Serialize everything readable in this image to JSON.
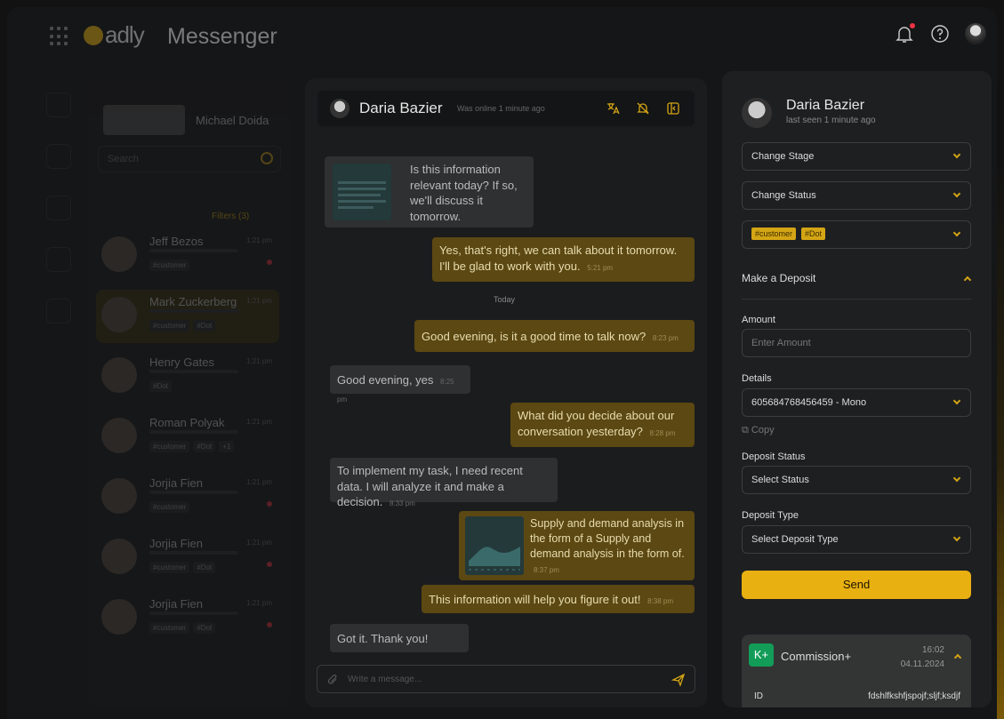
{
  "app": {
    "logo_text": "adly",
    "title": "Messenger"
  },
  "sidebar": {
    "user_name": "Michael Doida",
    "search_placeholder": "Search",
    "filters_label": "Filters (3)",
    "contacts": [
      {
        "name": "Jeff Bezos",
        "time": "1:21 pm",
        "tags": [
          "#customer"
        ],
        "unread": true
      },
      {
        "name": "Mark Zuckerberg",
        "time": "1:21 pm",
        "tags": [
          "#customer",
          "#Dot"
        ],
        "unread": false
      },
      {
        "name": "Henry Gates",
        "time": "1:21 pm",
        "tags": [
          "#Dot"
        ],
        "unread": false
      },
      {
        "name": "Roman Polyak",
        "time": "1:21 pm",
        "tags": [
          "#customer",
          "#Dot",
          "+1"
        ],
        "unread": false
      },
      {
        "name": "Jorjia Fien",
        "time": "1:21 pm",
        "tags": [
          "#customer"
        ],
        "unread": true
      },
      {
        "name": "Jorjia Fien",
        "time": "1:21 pm",
        "tags": [
          "#customer",
          "#Dot"
        ],
        "unread": true
      },
      {
        "name": "Jorjia Fien",
        "time": "1:21 pm",
        "tags": [
          "#customer",
          "#Dot"
        ],
        "unread": true
      }
    ]
  },
  "chat": {
    "contact_name": "Daria Bazier",
    "status": "Was online 1 minute ago",
    "today": "Today",
    "compose_placeholder": "Write a message...",
    "messages": [
      {
        "text": "Is this information relevant today? If so, we'll discuss it tomorrow.",
        "time": ""
      },
      {
        "text": "Yes, that's right, we can talk about it tomorrow. I'll be glad to work with you.",
        "time": "5:21 pm"
      },
      {
        "text": "Good evening, is it a good time to talk now?",
        "time": "8:23 pm"
      },
      {
        "text": "Good evening, yes",
        "time": "8:25 pm"
      },
      {
        "text": "What did you decide about our conversation yesterday?",
        "time": "8:28 pm"
      },
      {
        "text": "To implement my task, I need recent data. I will analyze it and make a decision.",
        "time": "8:33 pm"
      },
      {
        "text": "Supply and demand analysis in the form of a Supply and demand analysis in the form of.",
        "time": "8:37 pm"
      },
      {
        "text": "This information will help you figure it out!",
        "time": "8:38 pm"
      },
      {
        "text": "Got it. Thank you!",
        "time": ""
      }
    ]
  },
  "panel": {
    "name": "Daria Bazier",
    "last_seen": "last seen 1 minute ago",
    "change_stage": "Change Stage",
    "change_status": "Change Status",
    "tags": [
      "#customer",
      "#Dot"
    ],
    "section_title": "Make a Deposit",
    "amount_label": "Amount",
    "amount_placeholder": "Enter Amount",
    "details_label": "Details",
    "details_value": "605684768456459 - Mono",
    "copy_label": "Copy",
    "deposit_status_label": "Deposit Status",
    "deposit_status_value": "Select Status",
    "deposit_type_label": "Deposit Type",
    "deposit_type_value": "Select Deposit Type",
    "send_label": "Send",
    "commission": {
      "icon_text": "K+",
      "name": "Commission+",
      "time": "16:02",
      "date": "04.11.2024",
      "id_label": "ID",
      "id_value": "fdshlfkshfjspojf;sljf;ksdjf"
    }
  },
  "colors": {
    "accent": "#e9b012",
    "outgoing": "#5b4812",
    "incoming": "#2e3031",
    "commission_icon": "#139c58"
  }
}
